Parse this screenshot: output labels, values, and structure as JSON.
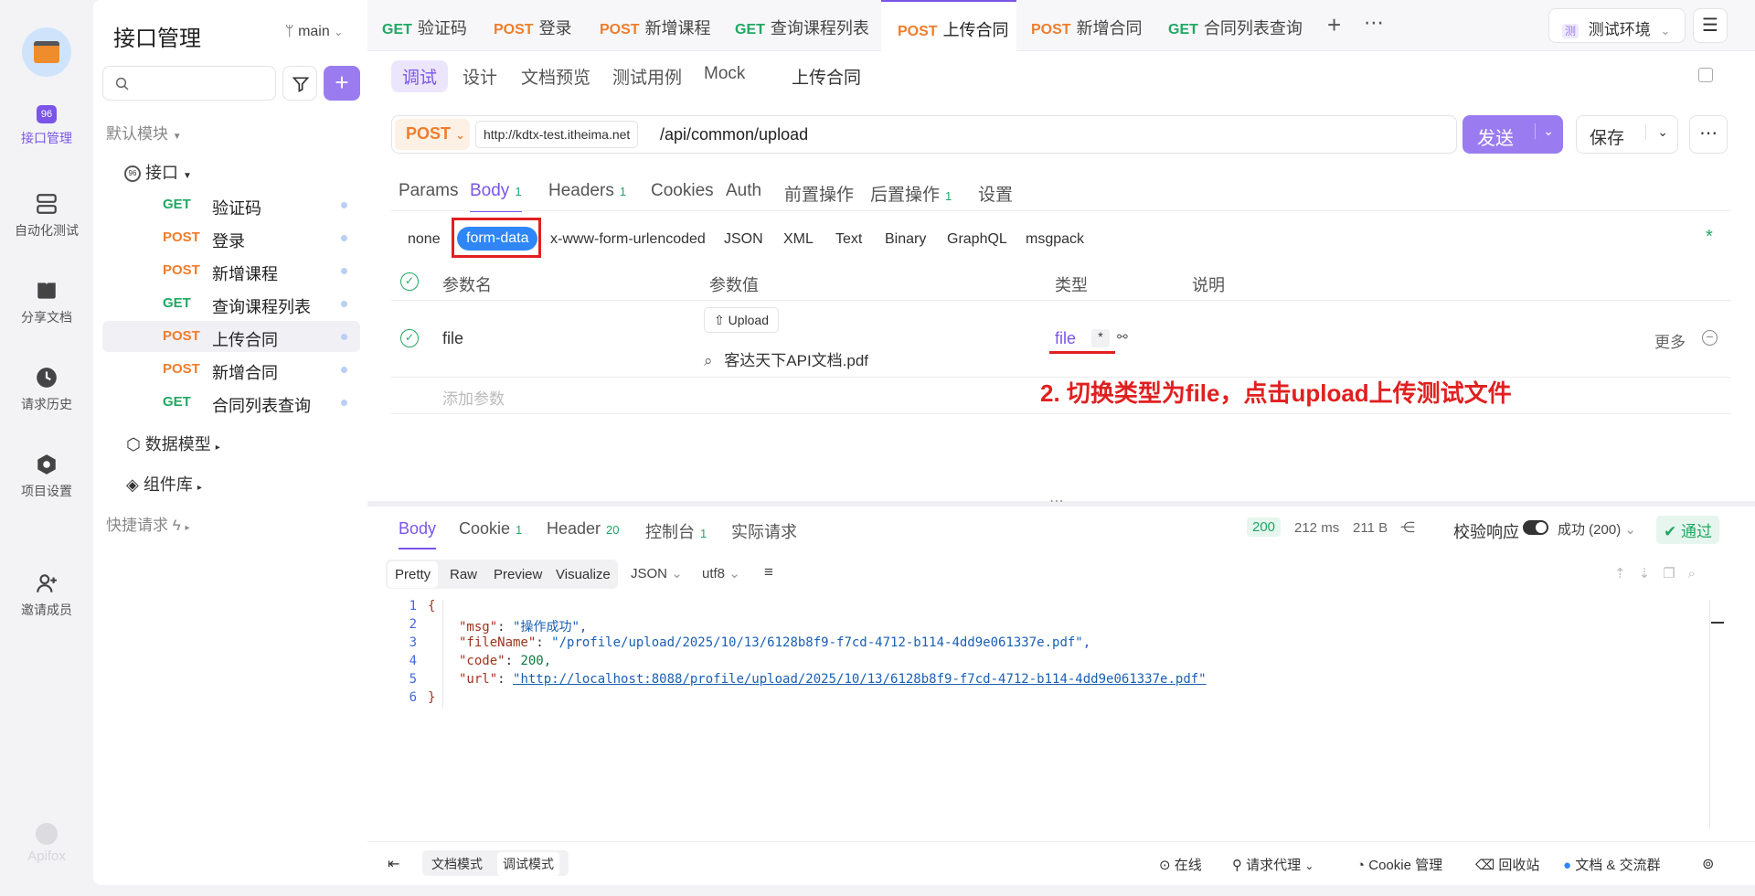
{
  "brand": {
    "name": "Apifox"
  },
  "rail": {
    "items": [
      {
        "label": "接口管理",
        "icon": "api-badge-icon"
      },
      {
        "label": "自动化测试",
        "icon": "stack-icon"
      },
      {
        "label": "分享文档",
        "icon": "book-icon"
      },
      {
        "label": "请求历史",
        "icon": "clock-icon"
      },
      {
        "label": "项目设置",
        "icon": "hexagon-gear-icon"
      },
      {
        "label": "邀请成员",
        "icon": "add-user-icon"
      }
    ]
  },
  "sidebar": {
    "title": "接口管理",
    "branch": "main",
    "default_module": "默认模块",
    "folder": "接口",
    "endpoints": [
      {
        "method": "GET",
        "name": "验证码"
      },
      {
        "method": "POST",
        "name": "登录"
      },
      {
        "method": "POST",
        "name": "新增课程"
      },
      {
        "method": "GET",
        "name": "查询课程列表"
      },
      {
        "method": "POST",
        "name": "上传合同"
      },
      {
        "method": "POST",
        "name": "新增合同"
      },
      {
        "method": "GET",
        "name": "合同列表查询"
      }
    ],
    "data_models": "数据模型",
    "components": "组件库",
    "quick_requests": "快捷请求"
  },
  "tabs": [
    {
      "method": "GET",
      "name": "验证码"
    },
    {
      "method": "POST",
      "name": "登录"
    },
    {
      "method": "POST",
      "name": "新增课程"
    },
    {
      "method": "GET",
      "name": "查询课程列表"
    },
    {
      "method": "POST",
      "name": "上传合同"
    },
    {
      "method": "POST",
      "name": "新增合同"
    },
    {
      "method": "GET",
      "name": "合同列表查询"
    }
  ],
  "env": {
    "badge": "测",
    "label": "测试环境"
  },
  "subtabs": {
    "debug": "调试",
    "design": "设计",
    "docs": "文档预览",
    "cases": "测试用例",
    "mock": "Mock",
    "name": "上传合同"
  },
  "request": {
    "method": "POST",
    "base": "http://kdtx-test.itheima.net",
    "path": "/api/common/upload",
    "send": "发送",
    "save": "保存"
  },
  "ptabs": {
    "params": "Params",
    "body": "Body",
    "body_n": "1",
    "headers": "Headers",
    "headers_n": "1",
    "cookies": "Cookies",
    "auth": "Auth",
    "pre": "前置操作",
    "post": "后置操作",
    "post_n": "1",
    "settings": "设置"
  },
  "body_types": [
    "none",
    "form-data",
    "x-www-form-urlencoded",
    "JSON",
    "XML",
    "Text",
    "Binary",
    "GraphQL",
    "msgpack"
  ],
  "columns": {
    "name": "参数名",
    "value": "参数值",
    "type": "类型",
    "desc": "说明"
  },
  "param": {
    "name": "file",
    "upload": "Upload",
    "file": "客达天下API文档.pdf",
    "type": "file",
    "required": "*",
    "more": "更多",
    "add": "添加参数"
  },
  "annotation": "2. 切换类型为file，点击upload上传测试文件",
  "response": {
    "tabs": {
      "body": "Body",
      "cookie": "Cookie",
      "cookie_n": "1",
      "header": "Header",
      "header_n": "20",
      "console": "控制台",
      "console_n": "1",
      "actual": "实际请求"
    },
    "status": "200",
    "time": "212 ms",
    "size": "211 B",
    "validate": "校验响应",
    "result": "成功 (200)",
    "pass": "通过",
    "views": [
      "Pretty",
      "Raw",
      "Preview",
      "Visualize"
    ],
    "format": "JSON",
    "encoding": "utf8",
    "lines": [
      {
        "n": "1",
        "t": "{"
      },
      {
        "n": "2",
        "key": "\"msg\"",
        "val": "\"操作成功\","
      },
      {
        "n": "3",
        "key": "\"fileName\"",
        "val": "\"/profile/upload/2025/10/13/6128b8f9-f7cd-4712-b114-4dd9e061337e.pdf\","
      },
      {
        "n": "4",
        "key": "\"code\"",
        "num": "200,"
      },
      {
        "n": "5",
        "key": "\"url\"",
        "val": "\"http://localhost:8088/profile/upload/2025/10/13/6128b8f9-f7cd-4712-b114-4dd9e061337e.pdf\""
      },
      {
        "n": "6",
        "t": "}"
      }
    ]
  },
  "footer": {
    "doc_mode": "文档模式",
    "debug_mode": "调试模式",
    "online": "在线",
    "proxy": "请求代理",
    "cookie": "Cookie 管理",
    "trash": "回收站",
    "community": "文档 & 交流群"
  },
  "colors": {
    "accent": "#7a55e8",
    "get": "#20a862",
    "post": "#ef7d2c",
    "annotation": "#e02020"
  }
}
